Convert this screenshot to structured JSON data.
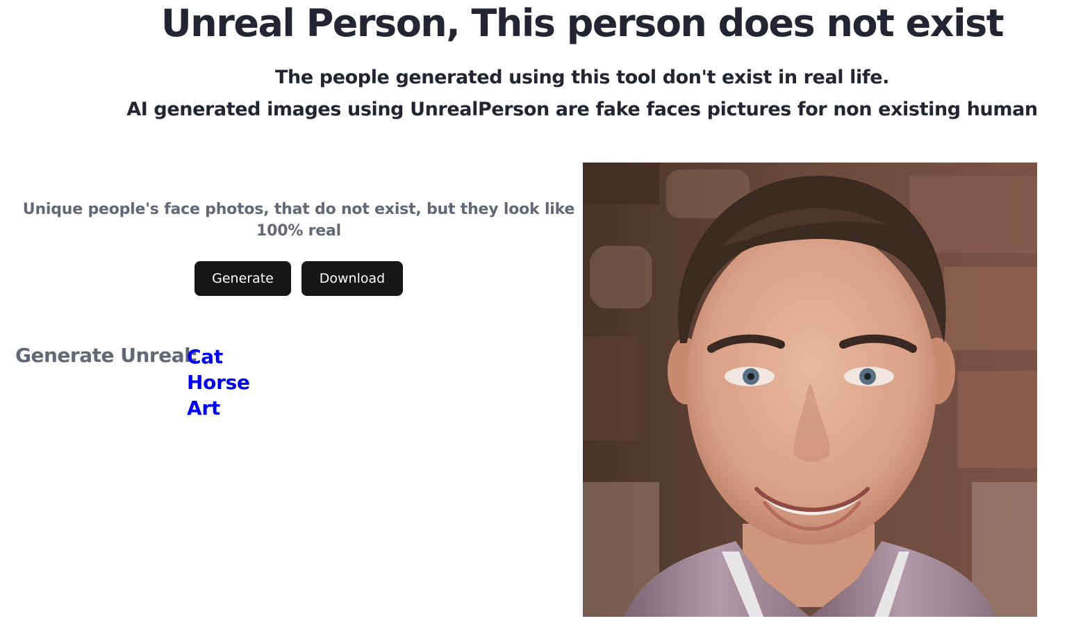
{
  "header": {
    "title": "Unreal Person, This person does not exist",
    "subtitle_line1": "The people generated using this tool don't exist in real life.",
    "subtitle_line2": "AI generated images using UnrealPerson are fake faces pictures for non existing human"
  },
  "main": {
    "tagline": "Unique people's face photos, that do not exist, but they look like 100% real",
    "buttons": {
      "generate_label": "Generate",
      "download_label": "Download"
    },
    "generate_unreal": {
      "label": "Generate Unreal:",
      "links": [
        "Cat",
        "Horse",
        "Art"
      ]
    },
    "photo": {
      "alt": "generated face"
    }
  },
  "colors": {
    "button_bg": "#161616",
    "link": "#0000ee",
    "muted_text": "#636776",
    "heading_text": "#232632"
  }
}
